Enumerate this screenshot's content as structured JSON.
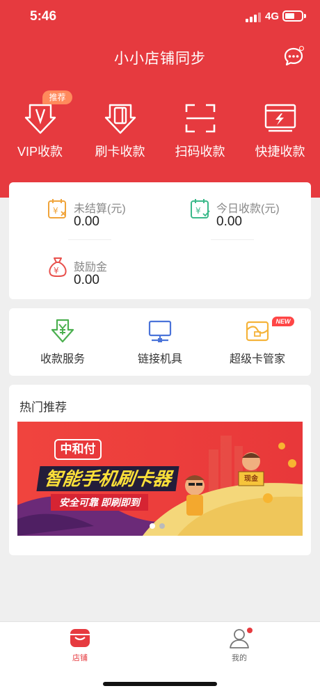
{
  "status_bar": {
    "time": "5:46",
    "network": "4G"
  },
  "header": {
    "title": "小小店铺同步",
    "message_icon": "chat-bubble-icon",
    "has_unread": true
  },
  "quick_pay": [
    {
      "label": "VIP收款",
      "icon": "vip-download-icon",
      "badge": "推荐"
    },
    {
      "label": "刷卡收款",
      "icon": "card-swipe-icon"
    },
    {
      "label": "扫码收款",
      "icon": "scan-frame-icon"
    },
    {
      "label": "快捷收款",
      "icon": "quick-pay-icon"
    }
  ],
  "balances": [
    {
      "label": "未结算(元)",
      "value": "0.00",
      "icon": "calendar-yen-x-icon",
      "color": "#f0a43a"
    },
    {
      "label": "今日收款(元)",
      "value": "0.00",
      "icon": "calendar-yen-check-icon",
      "color": "#3bb98a"
    },
    {
      "label": "鼓励金",
      "value": "0.00",
      "icon": "money-bag-icon",
      "color": "#e8504c"
    }
  ],
  "services": [
    {
      "label": "收款服务",
      "icon": "yen-arrow-icon",
      "color": "#4cb050"
    },
    {
      "label": "链接机具",
      "icon": "monitor-link-icon",
      "color": "#4a73d9"
    },
    {
      "label": "超级卡管家",
      "icon": "card-wallet-icon",
      "color": "#f5b33a",
      "badge": "NEW"
    }
  ],
  "hot": {
    "title": "热门推荐",
    "banner": {
      "brand": "中和付",
      "headline": "智能手机刷卡器",
      "slogan": "安全可靠 即刷即到",
      "sign_text": "现金",
      "pages": 2,
      "active_page": 1
    }
  },
  "tabbar": [
    {
      "label": "店铺",
      "icon": "store-icon",
      "active": true
    },
    {
      "label": "我的",
      "icon": "user-icon",
      "active": false,
      "has_dot": true
    }
  ],
  "colors": {
    "primary": "#e63a3f",
    "background": "#efefef",
    "card": "#ffffff"
  }
}
